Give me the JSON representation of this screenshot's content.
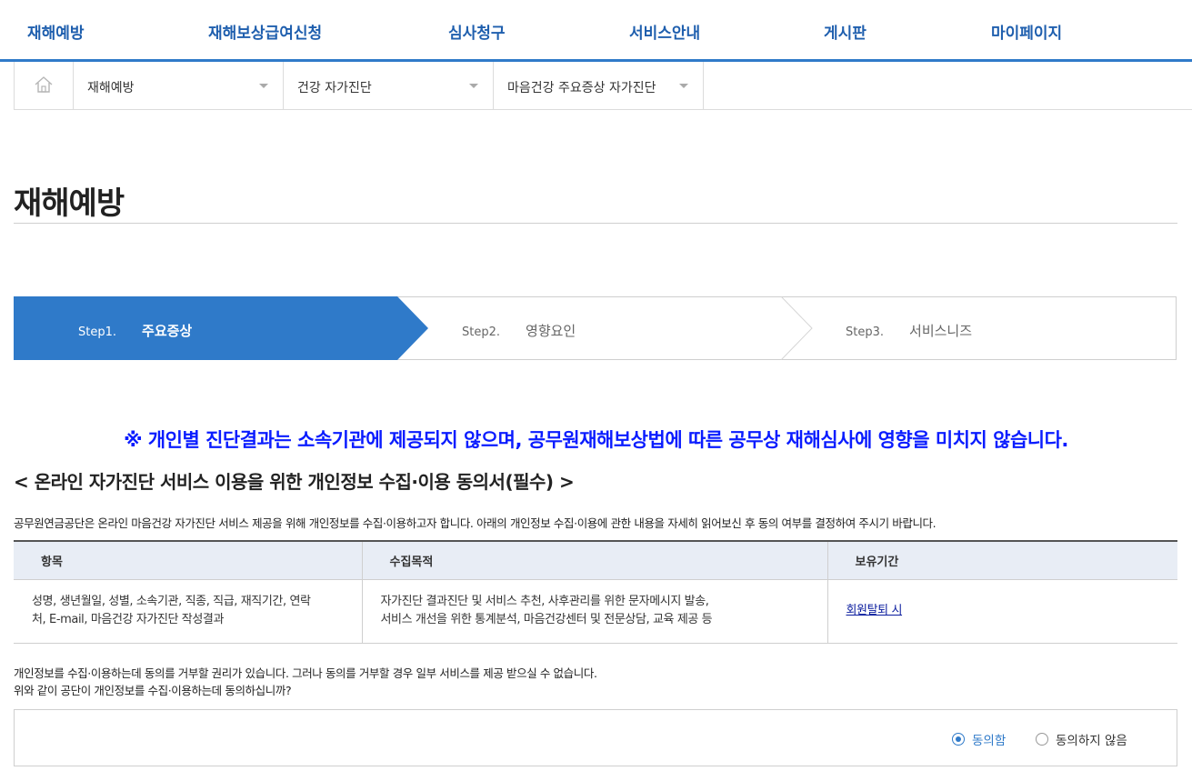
{
  "nav": {
    "items": [
      "재해예방",
      "재해보상급여신청",
      "심사청구",
      "서비스안내",
      "게시판",
      "마이페이지"
    ]
  },
  "breadcrumb": {
    "home_icon": "home-icon",
    "selects": [
      "재해예방",
      "건강 자가진단",
      "마음건강 주요증상 자가진단"
    ]
  },
  "page": {
    "title": "재해예방"
  },
  "steps": {
    "active_color": "#2f7ac9",
    "items": [
      {
        "no": "Step1.",
        "name": "주요증상",
        "active": true
      },
      {
        "no": "Step2.",
        "name": "영향요인",
        "active": false
      },
      {
        "no": "Step3.",
        "name": "서비스니즈",
        "active": false
      }
    ]
  },
  "notice": "※ 개인별 진단결과는 소속기관에 제공되지 않으며, 공무원재해보상법에 따른 공무상 재해심사에 영향을 미치지 않습니다.",
  "consent": {
    "title": "< 온라인 자가진단 서비스 이용을 위한 개인정보 수집·이용 동의서(필수) >",
    "intro": "공무원연금공단은 온라인 마음건강 자가진단 서비스 제공을 위해 개인정보를 수집·이용하고자 합니다. 아래의 개인정보 수집·이용에 관한 내용을 자세히 읽어보신 후 동의 여부를 결정하여 주시기 바랍니다.",
    "table": {
      "headers": [
        "항목",
        "수집목적",
        "보유기간"
      ],
      "row": {
        "items_line1": "성명, 생년월일, 성별, 소속기관, 직종, 직급, 재직기간, 연락",
        "items_line2": "처, E-mail, 마음건강 자가진단 작성결과",
        "purpose_line1": "자가진단 결과진단 및 서비스 추천, 사후관리를 위한 문자메시지 발송,",
        "purpose_line2": "서비스 개선을 위한 통계분석, 마음건강센터 및 전문상담, 교육 제공 등",
        "retention": "회원탈퇴 시"
      }
    },
    "refuse_line1": "개인정보를 수집·이용하는데 동의를 거부할 권리가 있습니다. 그러나 동의를 거부할 경우 일부 서비스를 제공 받으실 수 없습니다.",
    "refuse_line2": "위와 같이 공단이 개인정보를 수집·이용하는데 동의하십니까?",
    "options": {
      "agree": "동의함",
      "disagree": "동의하지 않음",
      "selected": "agree"
    }
  }
}
